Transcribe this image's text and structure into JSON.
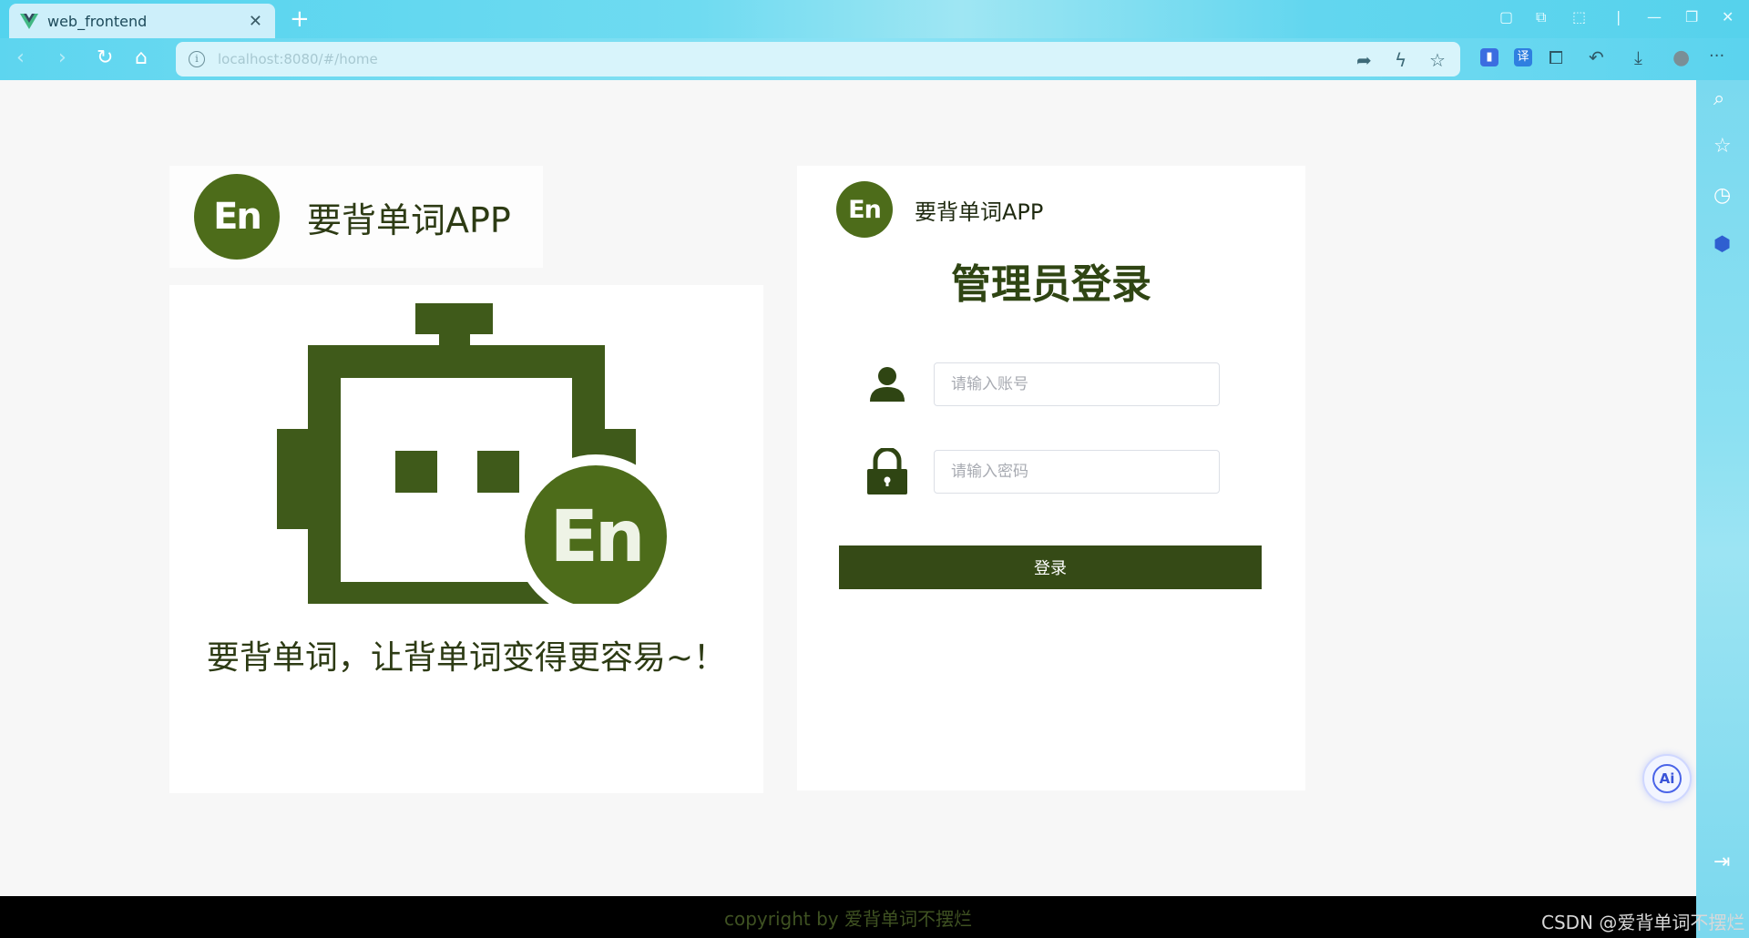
{
  "browser": {
    "tab_title": "web_frontend",
    "new_tab_label": "+",
    "url": "localhost:8080/#/home",
    "more_label": "···"
  },
  "brand": {
    "logo_text": "En",
    "app_name": "要背单词APP"
  },
  "hero": {
    "slogan": "要背单词，让背单词变得更容易~！"
  },
  "login": {
    "logo_text": "En",
    "app_name": "要背单词APP",
    "title": "管理员登录",
    "username_placeholder": "请输入账号",
    "password_placeholder": "请输入密码",
    "submit_label": "登录"
  },
  "footer": {
    "copyright": "copyright by 爱背单词不摆烂",
    "watermark": "CSDN @爱背单词不摆烂"
  },
  "widgets": {
    "ai_label": "Ai"
  },
  "colors": {
    "brand_green": "#4d6c1a",
    "dark_green": "#354a16",
    "browser_cyan": "#5dd5ef"
  }
}
